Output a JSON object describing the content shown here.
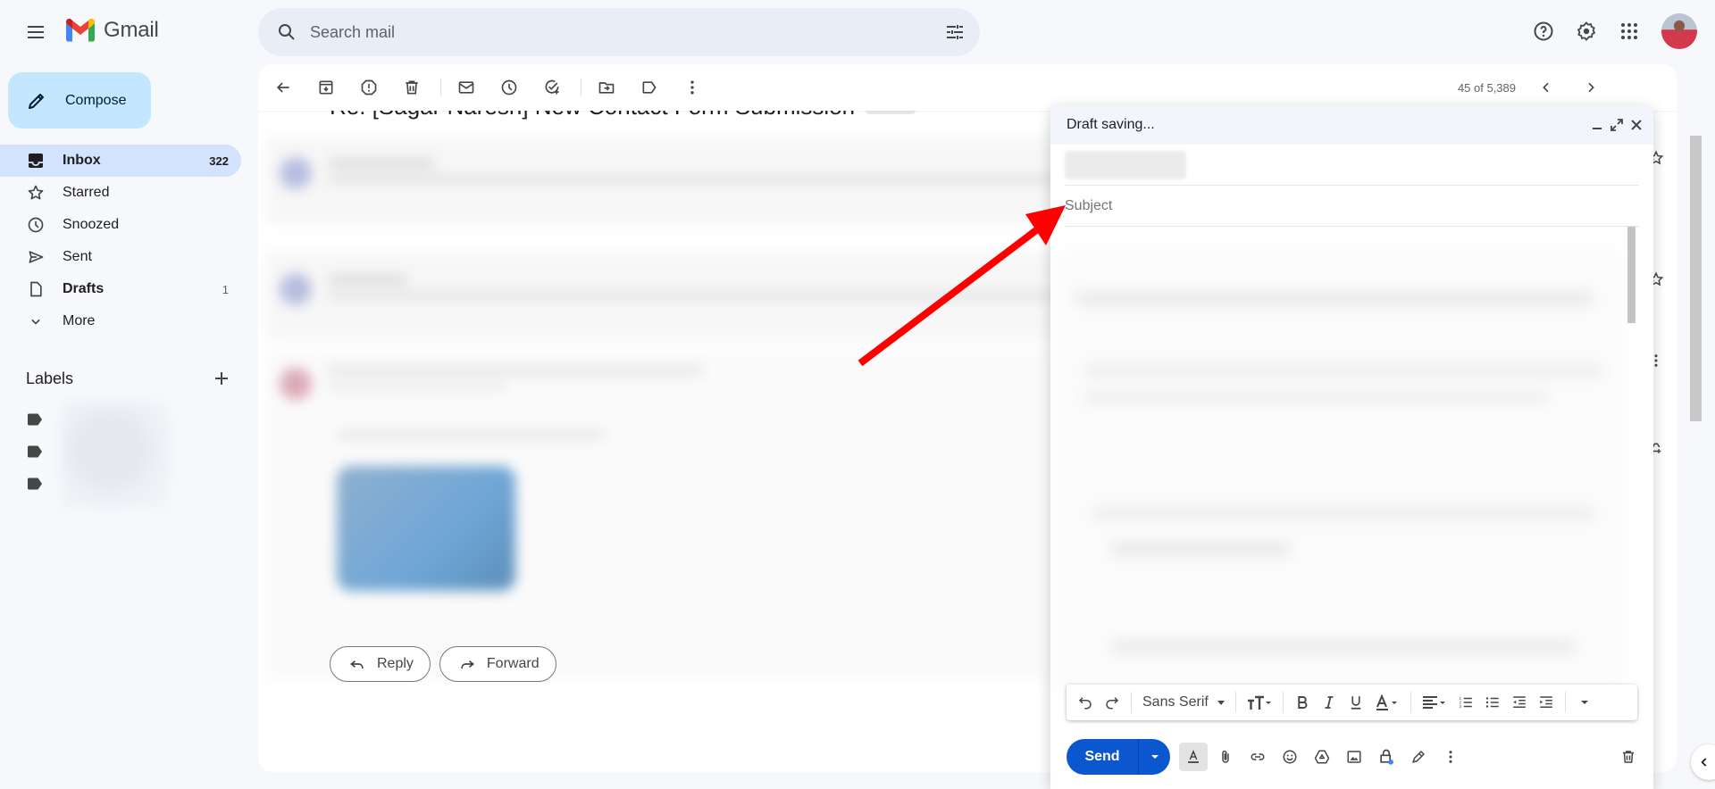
{
  "app": {
    "name": "Gmail"
  },
  "header": {
    "search_placeholder": "Search mail",
    "icons": [
      "menu-icon",
      "search-icon",
      "search-options-icon",
      "help-icon",
      "settings-icon",
      "apps-icon",
      "account-avatar"
    ]
  },
  "sidebar": {
    "compose_label": "Compose",
    "items": [
      {
        "label": "Inbox",
        "count": "322",
        "icon": "inbox-icon",
        "active": true
      },
      {
        "label": "Starred",
        "count": "",
        "icon": "star-icon"
      },
      {
        "label": "Snoozed",
        "count": "",
        "icon": "clock-icon"
      },
      {
        "label": "Sent",
        "count": "",
        "icon": "send-icon"
      },
      {
        "label": "Drafts",
        "count": "1",
        "icon": "draft-icon",
        "bold": true
      },
      {
        "label": "More",
        "count": "",
        "icon": "chevron-down-icon"
      }
    ],
    "labels_heading": "Labels"
  },
  "toolbar": {
    "icons": [
      "back-icon",
      "archive-icon",
      "report-spam-icon",
      "delete-icon",
      "mark-unread-icon",
      "snooze-icon",
      "add-task-icon",
      "move-to-icon",
      "label-icon",
      "more-icon"
    ],
    "pager_text": "45 of 5,389"
  },
  "thread": {
    "subject": "Re: [Sagar Naresh] New Contact Form Submission",
    "reply_label": "Reply",
    "forward_label": "Forward"
  },
  "compose": {
    "title": "Draft saving...",
    "subject_placeholder": "Subject",
    "font_name": "Sans Serif",
    "send_label": "Send",
    "colors": {
      "send": "#0b57d0",
      "header": "#f2f6fc"
    }
  },
  "annotation": {
    "arrow_color": "#ff0000"
  }
}
